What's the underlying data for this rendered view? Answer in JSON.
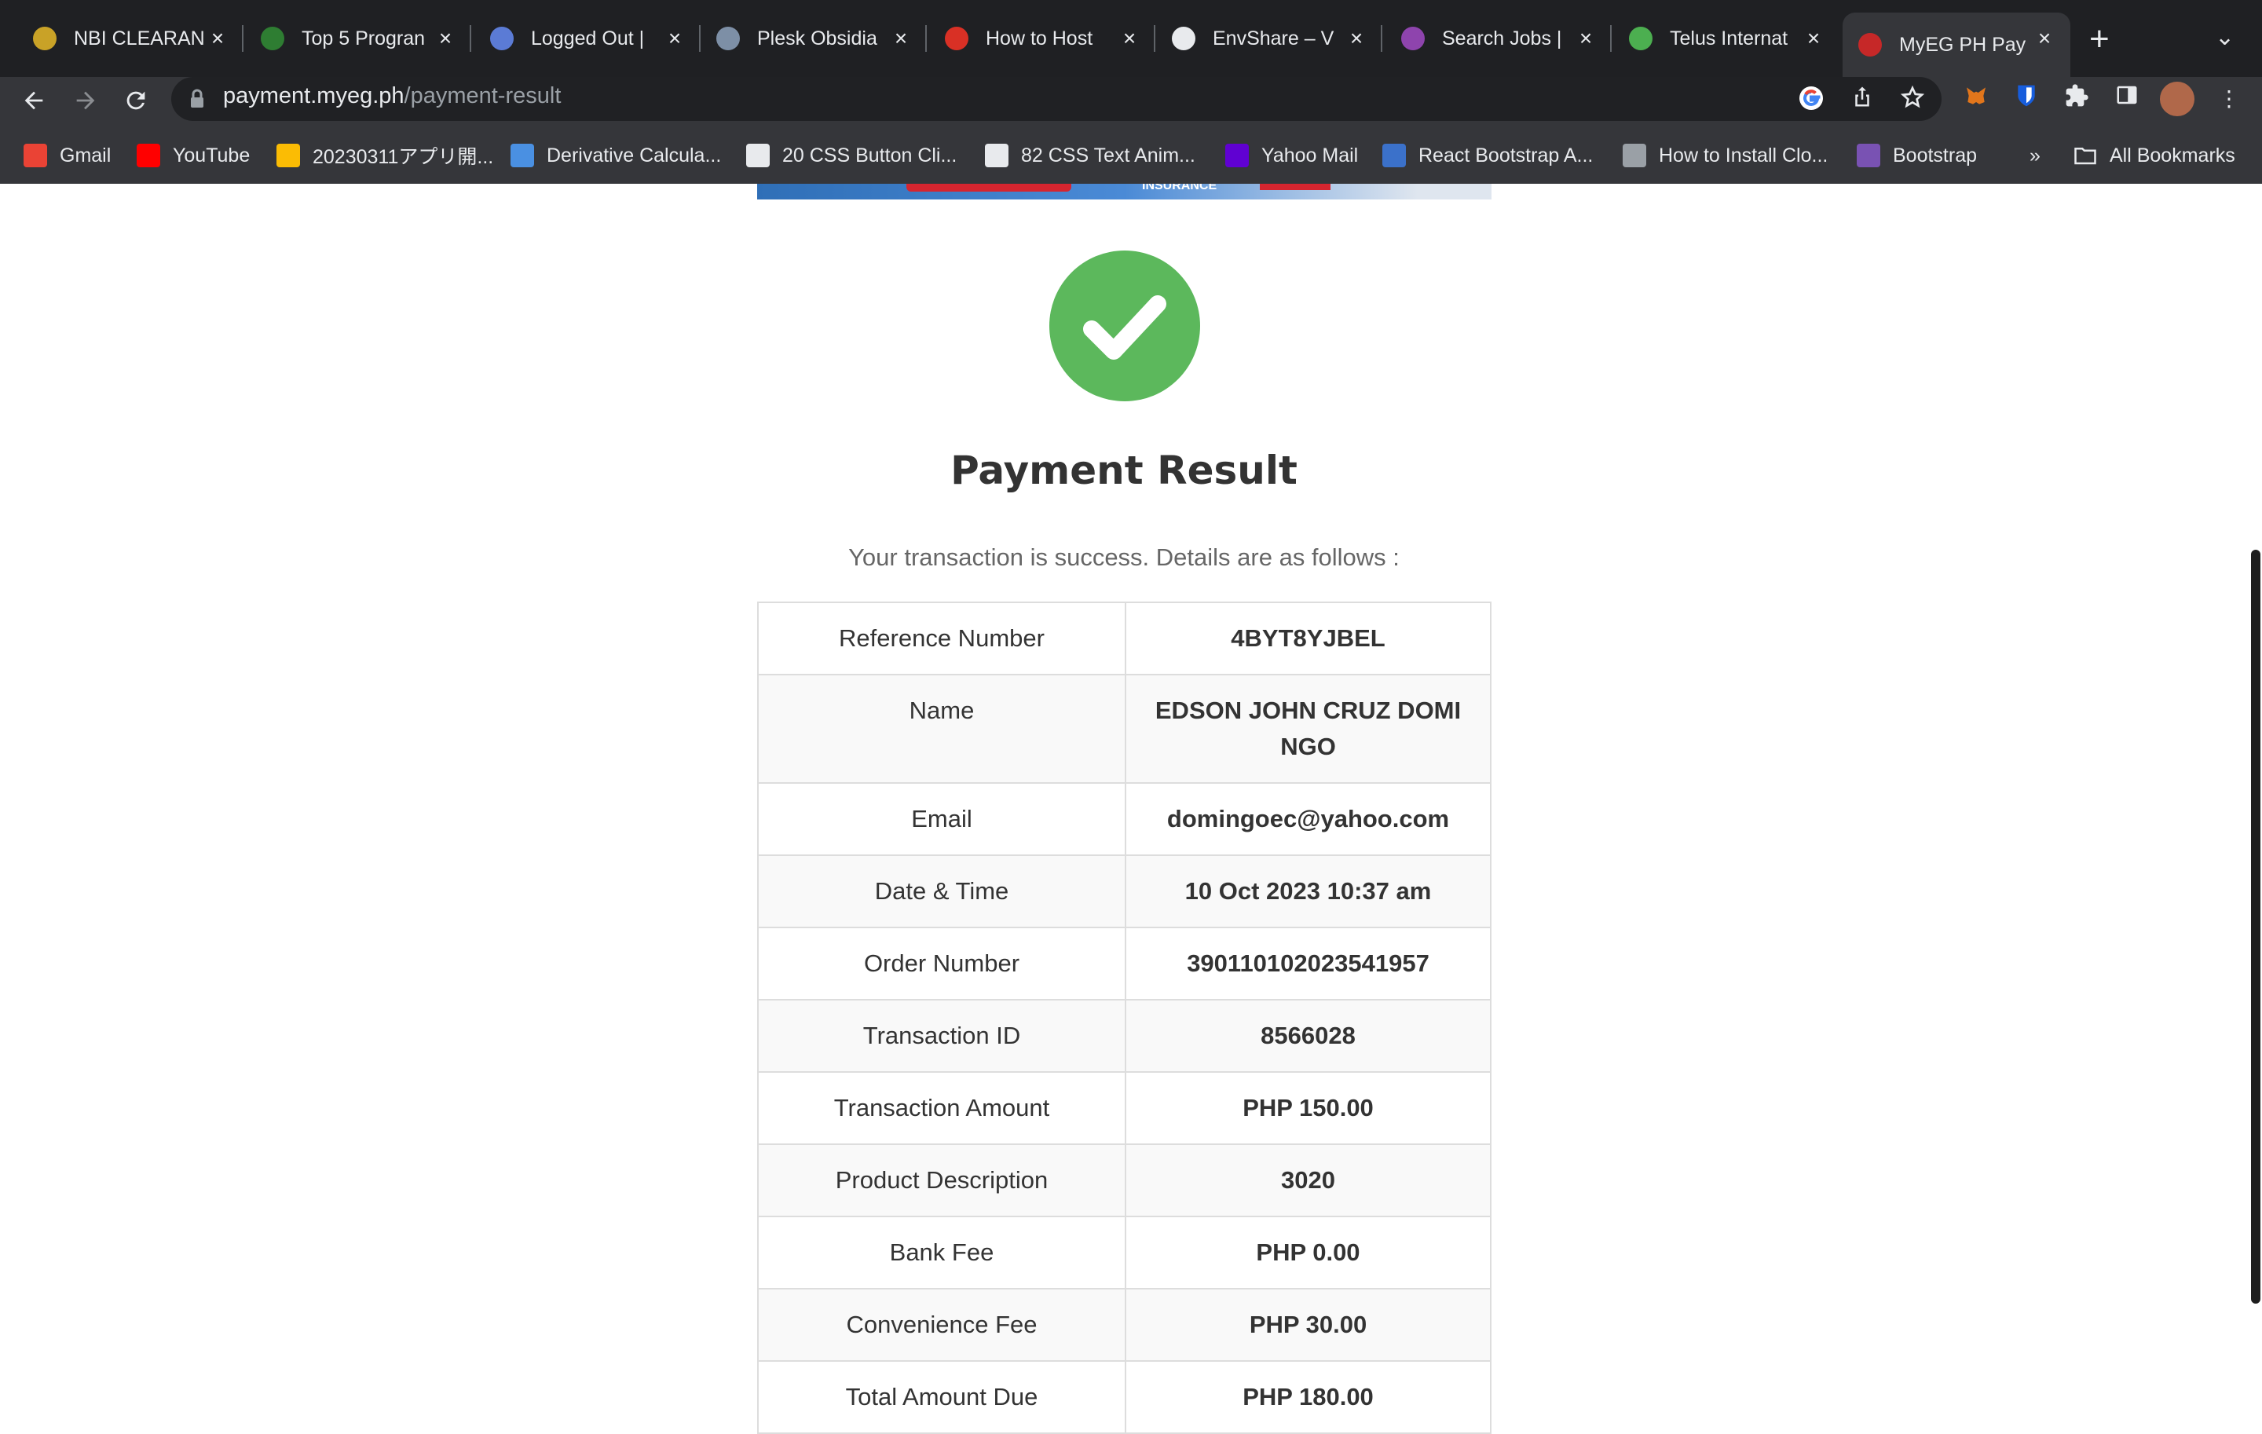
{
  "browser": {
    "tabs": [
      {
        "title": "NBI CLEARAN",
        "icon": "nbi-badge-icon",
        "color": "#c9a227"
      },
      {
        "title": "Top 5 Progran",
        "icon": "code-logo-icon",
        "color": "#2e7d32"
      },
      {
        "title": "Logged Out |",
        "icon": "v-logo-icon",
        "color": "#5b7bd5"
      },
      {
        "title": "Plesk Obsidia",
        "icon": "plesk-icon",
        "color": "#7d8fa6"
      },
      {
        "title": "How to Host",
        "icon": "red-logo-icon",
        "color": "#d93025"
      },
      {
        "title": "EnvShare – V",
        "icon": "triangle-logo-icon",
        "color": "#e8eaed"
      },
      {
        "title": "Search Jobs |",
        "icon": "purple-play-icon",
        "color": "#8e44ad"
      },
      {
        "title": "Telus Internat",
        "icon": "telus-leaf-icon",
        "color": "#4caf50"
      },
      {
        "title": "MyEG PH Pay",
        "icon": "myeg-icon",
        "color": "#c62828",
        "active": true
      }
    ],
    "new_tab": "+",
    "url_host": "payment.myeg.ph",
    "url_path": "/payment-result",
    "bookmarks": [
      {
        "label": "Gmail",
        "icon": "gmail-icon",
        "color": "#ea4335"
      },
      {
        "label": "YouTube",
        "icon": "youtube-icon",
        "color": "#ff0000"
      },
      {
        "label": "20230311アプリ開...",
        "icon": "drive-icon",
        "color": "#fbbc04"
      },
      {
        "label": "Derivative Calcula...",
        "icon": "infinity-icon",
        "color": "#4a90e2"
      },
      {
        "label": "20 CSS Button Cli...",
        "icon": "f-logo-icon",
        "color": "#e8eaed"
      },
      {
        "label": "82 CSS Text Anim...",
        "icon": "f-logo-icon",
        "color": "#e8eaed"
      },
      {
        "label": "Yahoo Mail",
        "icon": "yahoo-mail-icon",
        "color": "#6001d2"
      },
      {
        "label": "React Bootstrap A...",
        "icon": "mdb-icon",
        "color": "#3b71ca"
      },
      {
        "label": "How to Install Clo...",
        "icon": "moon-icon",
        "color": "#9aa0a6"
      },
      {
        "label": "Bootstrap",
        "icon": "bootstrap-icon",
        "color": "#7952b3"
      }
    ],
    "more": "»",
    "all_bookmarks": "All Bookmarks"
  },
  "banner": {
    "text": "INSURANCE"
  },
  "page": {
    "title": "Payment Result",
    "subtitle": "Your transaction is success. Details are as follows :",
    "success_color": "#5cb85c",
    "details": [
      {
        "label": "Reference Number",
        "value": "4BYT8YJBEL"
      },
      {
        "label": "Name",
        "value": "EDSON JOHN CRUZ DOMINGO"
      },
      {
        "label": "Email",
        "value": "domingoec@yahoo.com"
      },
      {
        "label": "Date & Time",
        "value": "10 Oct 2023 10:37 am"
      },
      {
        "label": "Order Number",
        "value": "390110102023541957"
      },
      {
        "label": "Transaction ID",
        "value": "8566028"
      },
      {
        "label": "Transaction Amount",
        "value": "PHP 150.00"
      },
      {
        "label": "Product Description",
        "value": "3020"
      },
      {
        "label": "Bank Fee",
        "value": "PHP  0.00"
      },
      {
        "label": "Convenience Fee",
        "value": "PHP  30.00"
      },
      {
        "label": "Total Amount Due",
        "value": "PHP  180.00"
      }
    ]
  }
}
